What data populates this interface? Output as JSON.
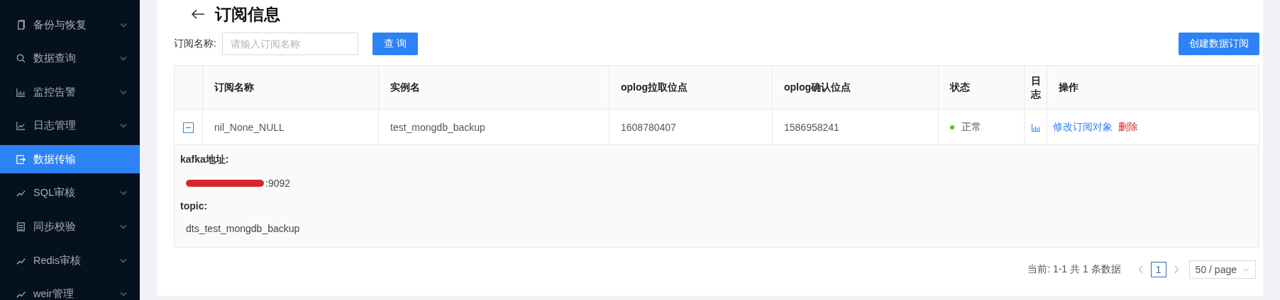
{
  "sidebar": {
    "items": [
      {
        "label": "备份与恢复",
        "selected": false,
        "expandable": true
      },
      {
        "label": "数据查询",
        "selected": false,
        "expandable": true
      },
      {
        "label": "监控告警",
        "selected": false,
        "expandable": true
      },
      {
        "label": "日志管理",
        "selected": false,
        "expandable": true
      },
      {
        "label": "数据传输",
        "selected": true,
        "expandable": false
      },
      {
        "label": "SQL审核",
        "selected": false,
        "expandable": true
      },
      {
        "label": "同步校验",
        "selected": false,
        "expandable": true
      },
      {
        "label": "Redis审核",
        "selected": false,
        "expandable": true
      },
      {
        "label": "weir管理",
        "selected": false,
        "expandable": true
      }
    ]
  },
  "header": {
    "title": "订阅信息"
  },
  "search": {
    "label": "订阅名称:",
    "placeholder": "请输入订阅名称",
    "button": "查 询",
    "create_button": "创建数据订阅"
  },
  "table": {
    "columns": [
      "订阅名称",
      "实例名",
      "oplog拉取位点",
      "oplog确认位点",
      "状态",
      "日志",
      "操作"
    ],
    "rows": [
      {
        "expanded": true,
        "name": "nil_None_NULL",
        "instance": "test_mongdb_backup",
        "pull_point": "1608780407",
        "confirm_point": "1586958241",
        "status": {
          "text": "正常",
          "color": "#52c41a"
        },
        "actions": [
          {
            "label": "修改订阅对象",
            "kind": "link"
          },
          {
            "label": "删除",
            "kind": "danger"
          }
        ],
        "details": [
          {
            "label": "kafka地址:",
            "value": ":9092",
            "redacted": true
          },
          {
            "label": "topic:",
            "value": "dts_test_mongdb_backup",
            "redacted": false
          }
        ]
      }
    ]
  },
  "pagination": {
    "summary": "当前: 1-1 共 1 条数据",
    "pages": [
      {
        "label": "1",
        "selected": true
      }
    ],
    "page_size": "50 / page"
  }
}
